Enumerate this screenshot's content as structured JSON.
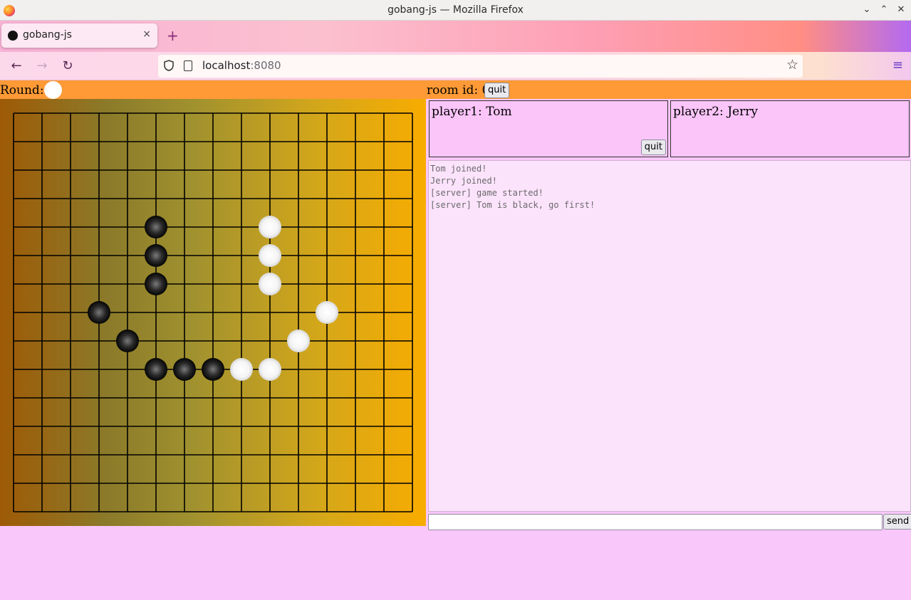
{
  "window": {
    "title": "gobang-js — Mozilla Firefox"
  },
  "tab": {
    "label": "gobang-js",
    "close": "×",
    "new_tab": "+"
  },
  "nav": {
    "back": "←",
    "forward": "→",
    "reload": "↻",
    "url_host": "localhost",
    "url_port": ":8080",
    "star": "☆",
    "menu": "≡"
  },
  "game": {
    "round_label": "Round:",
    "round_stone": "white",
    "room_label": "room id: 0",
    "quit_label": "quit",
    "player1": "player1: Tom",
    "player2": "player2: Jerry",
    "log": [
      "Tom joined!",
      "Jerry joined!",
      "[server] game started!",
      "[server] Tom is black, go first!"
    ],
    "chat_input": "",
    "send_label": "send",
    "board_size": 15,
    "black_stones": [
      [
        5,
        4
      ],
      [
        5,
        5
      ],
      [
        5,
        6
      ],
      [
        3,
        7
      ],
      [
        4,
        8
      ],
      [
        5,
        9
      ],
      [
        6,
        9
      ],
      [
        7,
        9
      ]
    ],
    "white_stones": [
      [
        9,
        4
      ],
      [
        9,
        5
      ],
      [
        9,
        6
      ],
      [
        11,
        7
      ],
      [
        10,
        8
      ],
      [
        8,
        9
      ],
      [
        9,
        9
      ]
    ]
  },
  "colors": {
    "accent_orange": "#ff9a36",
    "page_pink": "#f9c7f9",
    "log_pink": "#fce3fc"
  }
}
